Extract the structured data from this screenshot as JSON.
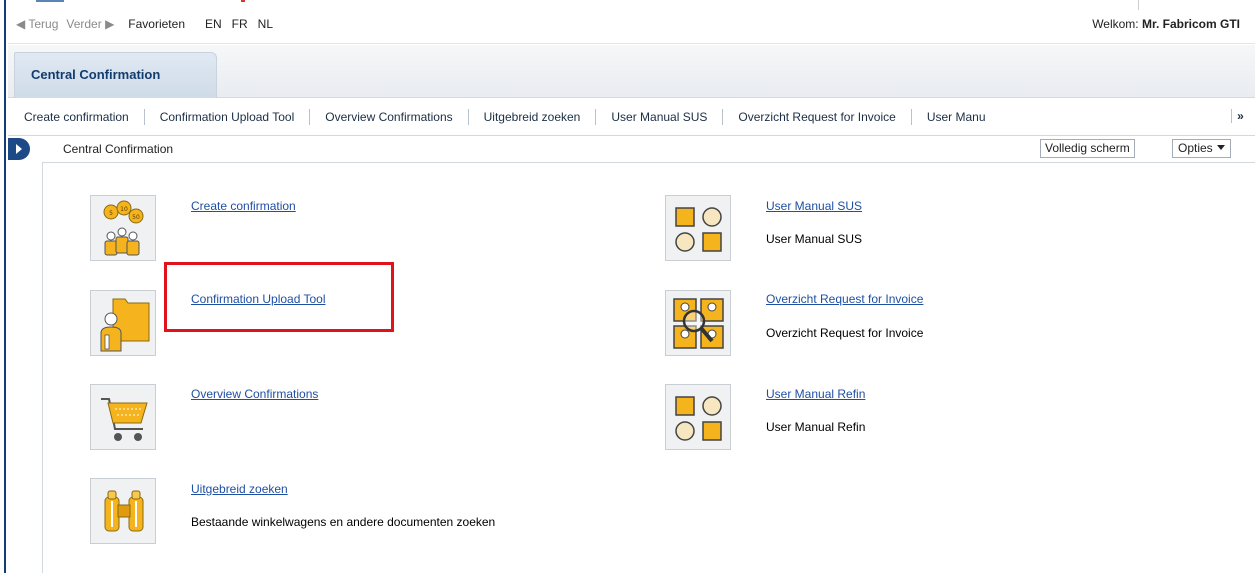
{
  "topnav": {
    "back": "◀ Terug",
    "forward": "Verder ▶",
    "favorites": "Favorieten",
    "languages": [
      "EN",
      "FR",
      "NL"
    ],
    "welcome_prefix": "Welkom:",
    "welcome_user": "Mr. Fabricom GTI"
  },
  "main_tab": {
    "label": "Central Confirmation"
  },
  "subtabs": [
    "Create confirmation",
    "Confirmation Upload Tool",
    "Overview Confirmations",
    "Uitgebreid zoeken",
    "User Manual SUS",
    "Overzicht Request for Invoice",
    "User Manu"
  ],
  "subtabs_more": "»",
  "content_header": {
    "title": "Central Confirmation",
    "fullscreen": "Volledig scherm",
    "options": "Opties"
  },
  "tiles": {
    "create": {
      "link": "Create confirmation",
      "icon": "coins-people-icon"
    },
    "upload": {
      "link": "Confirmation Upload Tool",
      "icon": "folder-person-icon"
    },
    "overview": {
      "link": "Overview Confirmations",
      "icon": "shopping-cart-icon"
    },
    "search": {
      "link": "Uitgebreid zoeken",
      "desc": "Bestaande winkelwagens en andere documenten zoeken",
      "icon": "binoculars-icon"
    },
    "manual_sus": {
      "link": "User Manual SUS",
      "desc": "User Manual SUS",
      "icon": "shapes-grid-icon"
    },
    "rfi": {
      "link": "Overzicht Request for Invoice",
      "desc": "Overzicht Request for Invoice",
      "icon": "people-magnifier-icon"
    },
    "manual_refin": {
      "link": "User Manual Refin",
      "desc": "User Manual Refin",
      "icon": "shapes-grid-icon"
    }
  },
  "colors": {
    "accent_gold": "#f5b41d",
    "dark_blue": "#1d4a86",
    "link": "#1f4fa3",
    "highlight": "#e0121b"
  }
}
